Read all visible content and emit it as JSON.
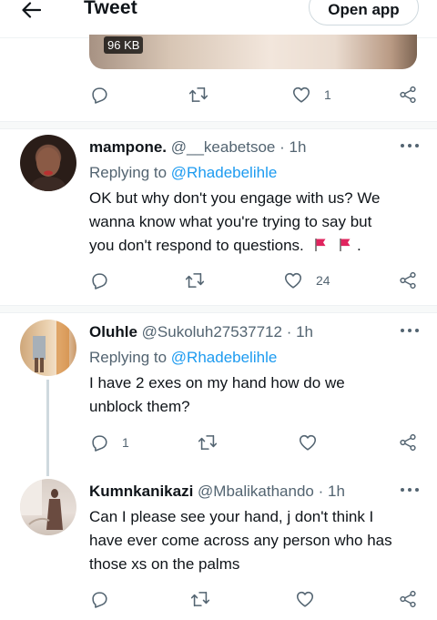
{
  "header": {
    "title": "Tweet",
    "open_app_label": "Open app"
  },
  "media_card": {
    "size_badge": "96 KB"
  },
  "main_tweet_actions": {
    "replies": "",
    "retweets": "",
    "likes": "1"
  },
  "replies": [
    {
      "name": "mampone.",
      "handle": "@__keabetsoe",
      "time": "· 1h",
      "replying_to_prefix": "Replying to",
      "replying_to": "@Rhadebelihle",
      "text_lines": [
        "OK but why don't you engage with us? We",
        "wanna know what you're trying to say but",
        "you don't respond to questions."
      ],
      "text_suffix": ".",
      "stats": {
        "replies": "",
        "retweets": "",
        "likes": "24"
      }
    },
    {
      "name": "Oluhle",
      "handle": "@Sukoluh27537712",
      "time": "· 1h",
      "replying_to_prefix": "Replying to",
      "replying_to": "@Rhadebelihle",
      "text_lines": [
        "I have 2 exes on my hand how do we",
        "unblock them?"
      ],
      "stats": {
        "replies": "1",
        "retweets": "",
        "likes": ""
      }
    },
    {
      "name": "Kumnkanikazi",
      "handle": "@Mbalikathando",
      "time": "· 1h",
      "text_lines": [
        "Can I please  see your hand, j don't think I",
        "have ever come across any person who has",
        "those xs on the palms"
      ],
      "stats": {
        "replies": "",
        "retweets": "",
        "likes": ""
      }
    }
  ],
  "colors": {
    "accent": "#1d9bf0",
    "text": "#0f1419",
    "muted": "#536471",
    "flag": "#e0245e"
  },
  "icons": [
    "back-arrow-icon",
    "reply-icon",
    "retweet-icon",
    "like-icon",
    "share-icon",
    "more-icon",
    "red-flag-icon"
  ]
}
